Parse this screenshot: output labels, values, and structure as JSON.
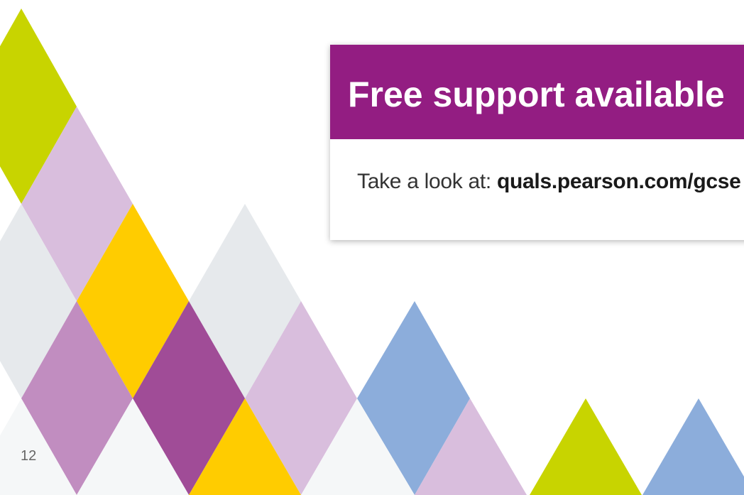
{
  "support_card": {
    "title": "Free support available",
    "body_prefix": "Take a look at: ",
    "link_text": "quals.pearson.com/gcse"
  },
  "page": {
    "number": "12"
  },
  "colors": {
    "header_purple": "#931d82",
    "lime": "#c8d400",
    "light_lilac": "#d9bedd",
    "grey": "#e6e9ec",
    "yellow": "#ffcc00",
    "mid_purple": "#c18dc0",
    "dark_purple": "#a04c97",
    "blue": "#8caddb",
    "very_light": "#f5f7f8"
  }
}
